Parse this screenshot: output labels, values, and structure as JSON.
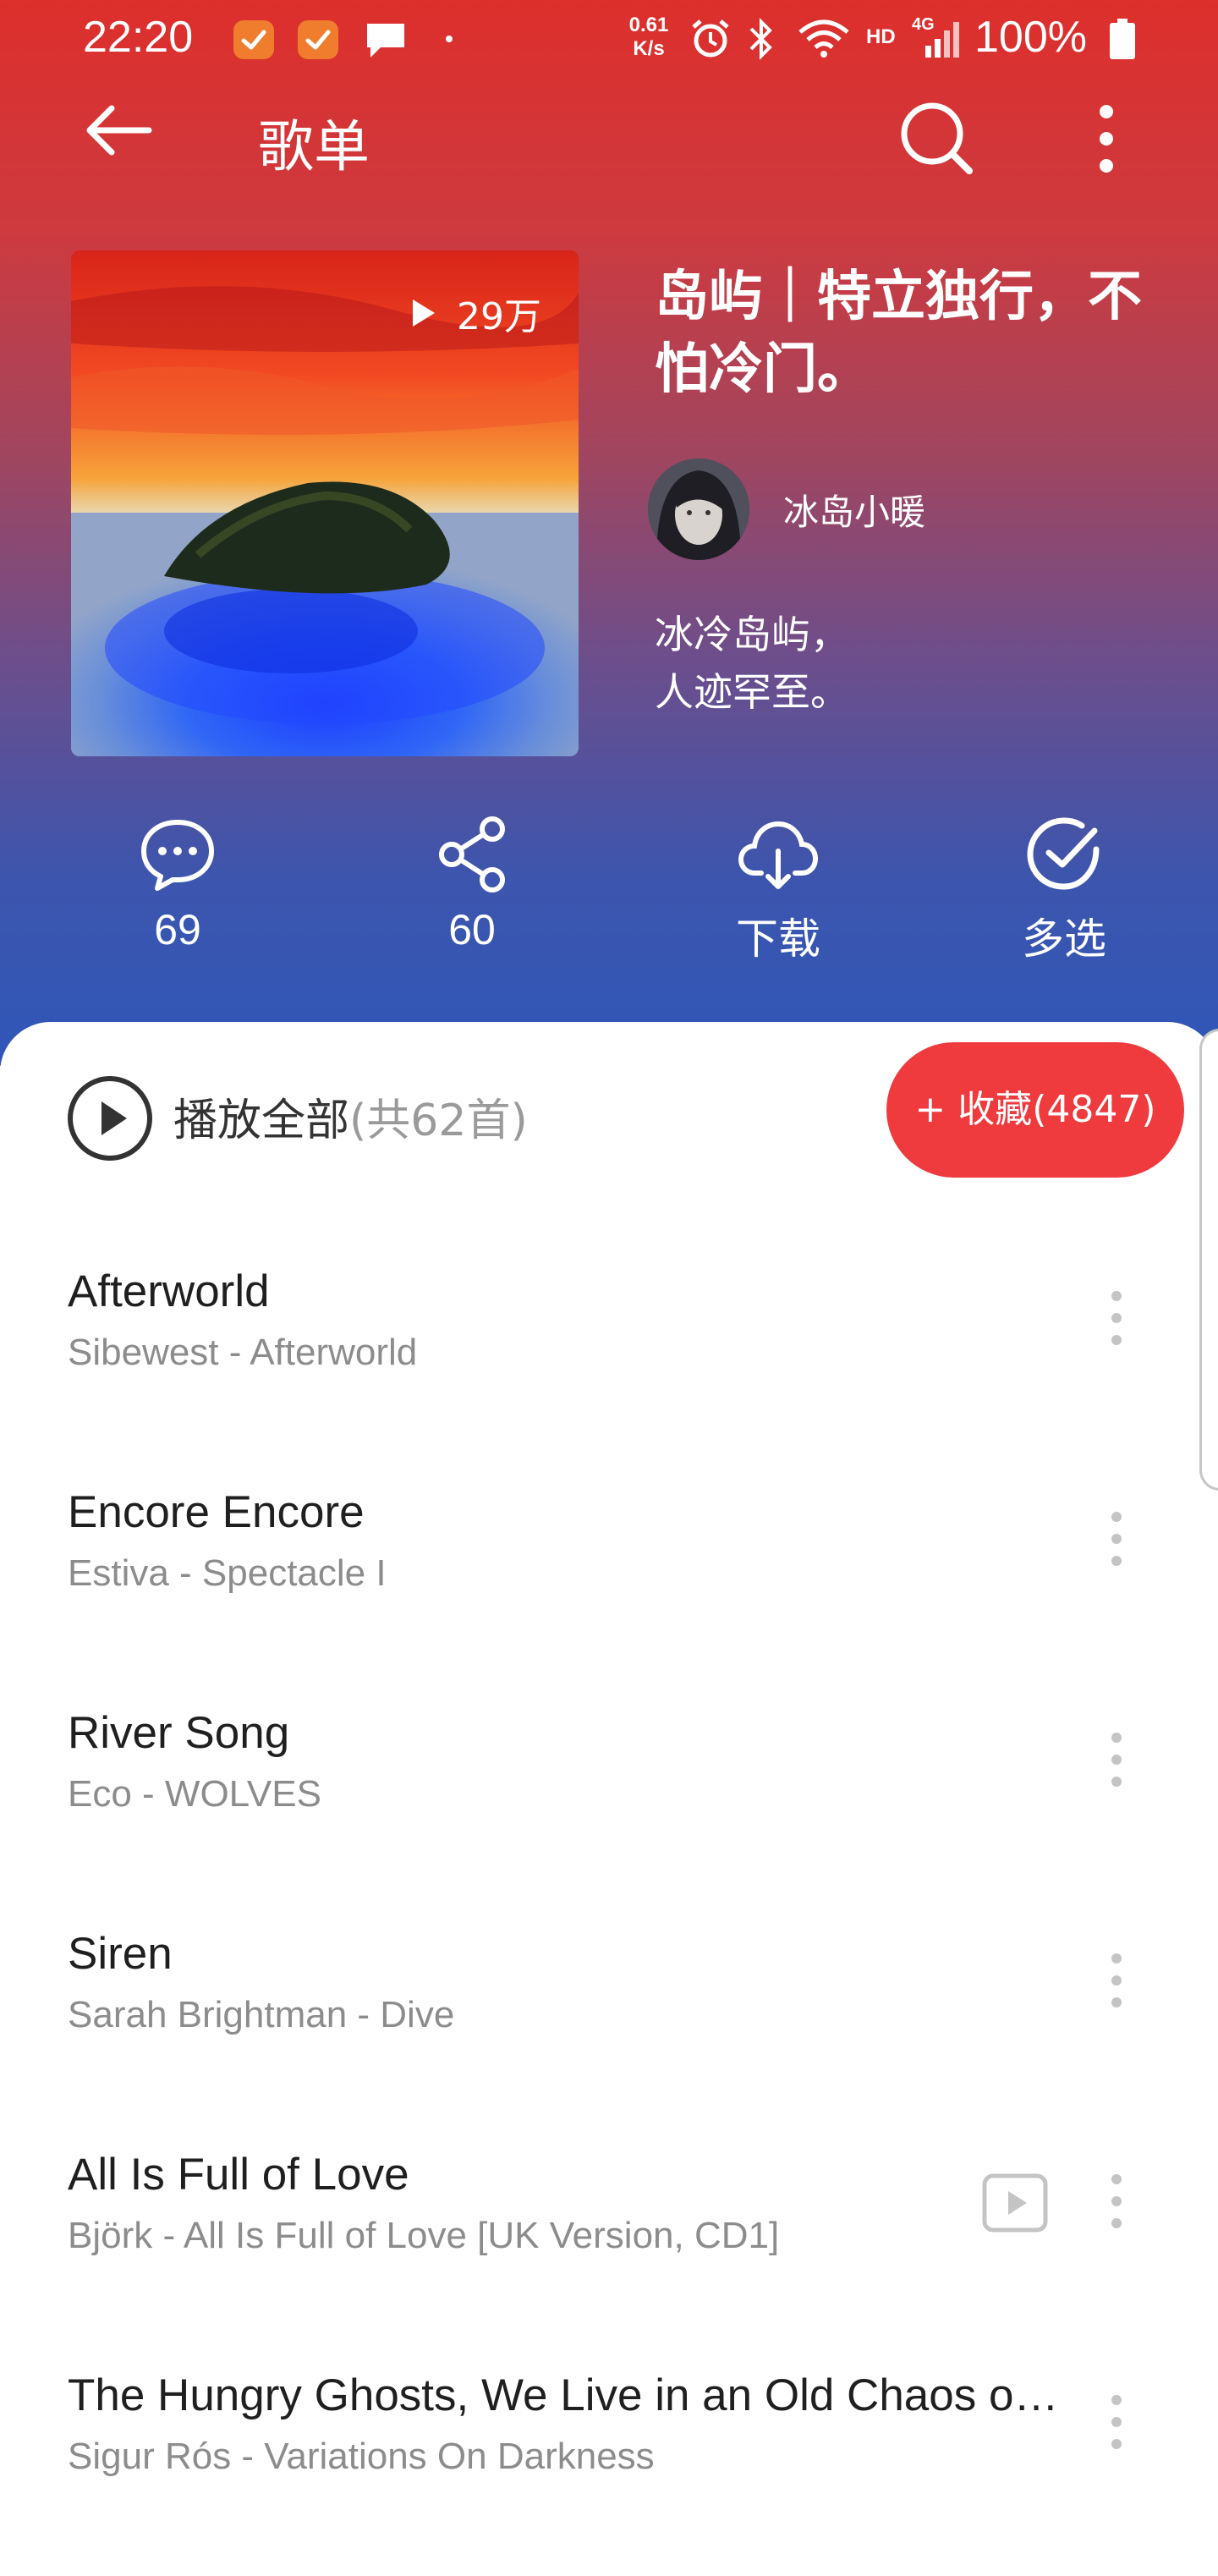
{
  "status_bar": {
    "time": "22:20",
    "net_speed_value": "0.61",
    "net_speed_unit": "K/s",
    "signal_labels": [
      "HD",
      "4G"
    ],
    "battery": "100%"
  },
  "header": {
    "title": "歌单",
    "icons": [
      "back-arrow-icon",
      "search-icon",
      "more-vertical-icon"
    ]
  },
  "playlist": {
    "play_count": "29万",
    "title": "岛屿｜特立独行，不怕冷门。",
    "creator": "冰岛小暖",
    "description_lines": [
      "冰冷岛屿，",
      "人迹罕至。"
    ]
  },
  "actions": [
    {
      "icon": "comment-icon",
      "label": "69"
    },
    {
      "icon": "share-icon",
      "label": "60"
    },
    {
      "icon": "download-icon",
      "label": "下载"
    },
    {
      "icon": "multi-select-icon",
      "label": "多选"
    }
  ],
  "play_all": {
    "label": "播放全部",
    "count": "(共62首)"
  },
  "collect_button": "+ 收藏(4847)",
  "songs": [
    {
      "title": "Afterworld",
      "subtitle": "Sibewest - Afterworld",
      "mv": false
    },
    {
      "title": "Encore Encore",
      "subtitle": "Estiva - Spectacle I",
      "mv": false
    },
    {
      "title": "River Song",
      "subtitle": "Eco - WOLVES",
      "mv": false
    },
    {
      "title": "Siren",
      "subtitle": "Sarah Brightman - Dive",
      "mv": false
    },
    {
      "title": "All Is Full of Love",
      "subtitle": "Björk - All Is Full of Love [UK Version, CD1]",
      "mv": true
    },
    {
      "title": "The Hungry Ghosts, We Live in an Old Chaos of the Rotten Sun",
      "subtitle": "Sigur Rós - Variations On Darkness",
      "mv": false
    }
  ],
  "colors": {
    "accent": "#ef3a3e",
    "hero_top": "#dd2f2c",
    "hero_bottom": "#2f57b8"
  }
}
